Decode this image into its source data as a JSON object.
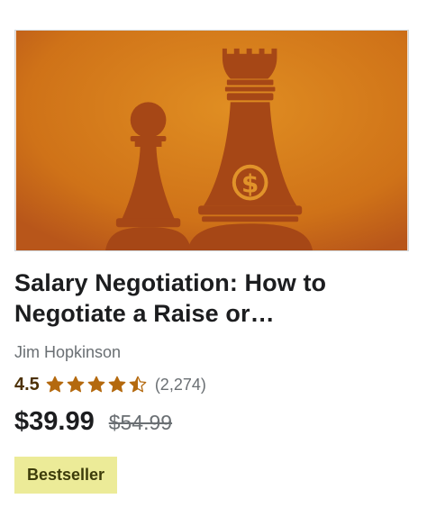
{
  "course": {
    "thumbnail_icon": "chess-pieces-icon",
    "title": "Salary Negotiation: How to Negotiate a Raise or…",
    "instructor": "Jim Hopkinson",
    "rating": "4.5",
    "rating_value": 4.5,
    "rating_max": 5,
    "rating_count": "(2,274)",
    "price_current": "$39.99",
    "price_original": "$54.99",
    "badge": "Bestseller"
  },
  "colors": {
    "thumb_light": "#de8a1e",
    "thumb_dark": "#b7511a",
    "chess_piece": "#a64716",
    "star": "#b4690e",
    "badge_bg": "#eceb98"
  }
}
